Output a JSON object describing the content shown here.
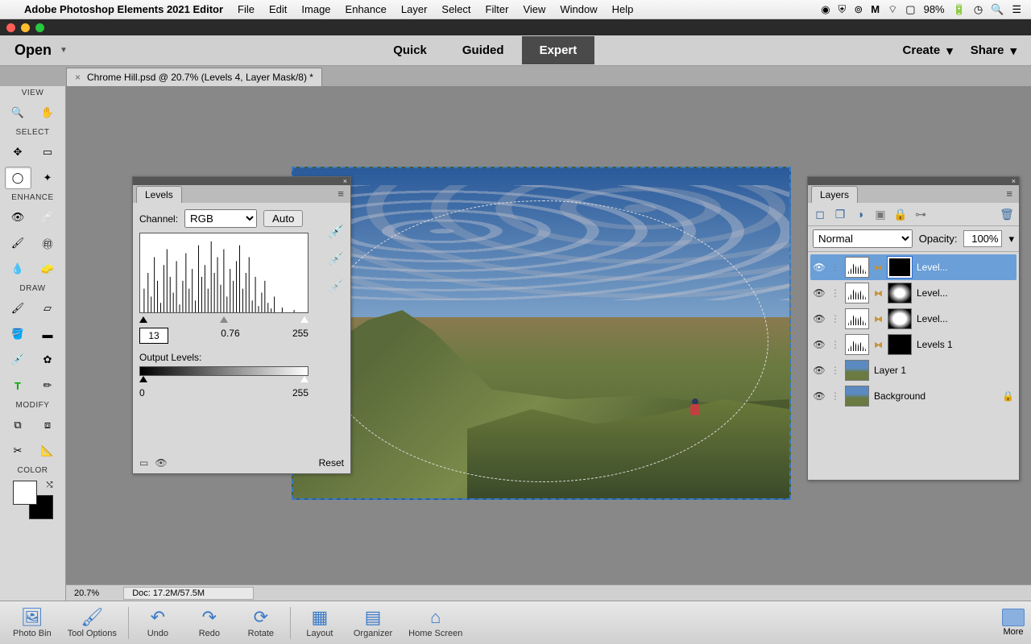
{
  "mac": {
    "app_name": "Adobe Photoshop Elements 2021 Editor",
    "menus": [
      "File",
      "Edit",
      "Image",
      "Enhance",
      "Layer",
      "Select",
      "Filter",
      "View",
      "Window",
      "Help"
    ],
    "battery": "98%"
  },
  "toolbar": {
    "open": "Open",
    "modes": {
      "quick": "Quick",
      "guided": "Guided",
      "expert": "Expert"
    },
    "create": "Create",
    "share": "Share"
  },
  "doc_tab": "Chrome Hill.psd @ 20.7% (Levels 4, Layer Mask/8) *",
  "toolbox": {
    "sections": {
      "view": "VIEW",
      "select": "SELECT",
      "enhance": "ENHANCE",
      "draw": "DRAW",
      "modify": "MODIFY",
      "color": "COLOR"
    }
  },
  "levels": {
    "title": "Levels",
    "channel_label": "Channel:",
    "channel": "RGB",
    "auto": "Auto",
    "inputs": {
      "black": "13",
      "gamma": "0.76",
      "white": "255"
    },
    "output_label": "Output Levels:",
    "outputs": {
      "black": "0",
      "white": "255"
    },
    "reset": "Reset"
  },
  "layers": {
    "title": "Layers",
    "blend_mode": "Normal",
    "opacity_label": "Opacity:",
    "opacity": "100%",
    "items": [
      {
        "name": "Level...",
        "type": "adj",
        "mask": "black",
        "sel": true
      },
      {
        "name": "Level...",
        "type": "adj",
        "mask": "radial"
      },
      {
        "name": "Level...",
        "type": "adj",
        "mask": "radial2"
      },
      {
        "name": "Levels 1",
        "type": "adj",
        "mask": "black"
      },
      {
        "name": "Layer 1",
        "type": "img"
      },
      {
        "name": "Background",
        "type": "img",
        "locked": true
      }
    ]
  },
  "status": {
    "zoom": "20.7%",
    "doc": "Doc: 17.2M/57.5M"
  },
  "bottom": {
    "buttons": [
      {
        "label": "Photo Bin",
        "icon": "🖼"
      },
      {
        "label": "Tool Options",
        "icon": "🖌"
      },
      {
        "label": "Undo",
        "icon": "↶"
      },
      {
        "label": "Redo",
        "icon": "↷"
      },
      {
        "label": "Rotate",
        "icon": "⟳"
      },
      {
        "label": "Layout",
        "icon": "▦"
      },
      {
        "label": "Organizer",
        "icon": "▤"
      },
      {
        "label": "Home Screen",
        "icon": "⌂"
      }
    ],
    "more": "More"
  }
}
